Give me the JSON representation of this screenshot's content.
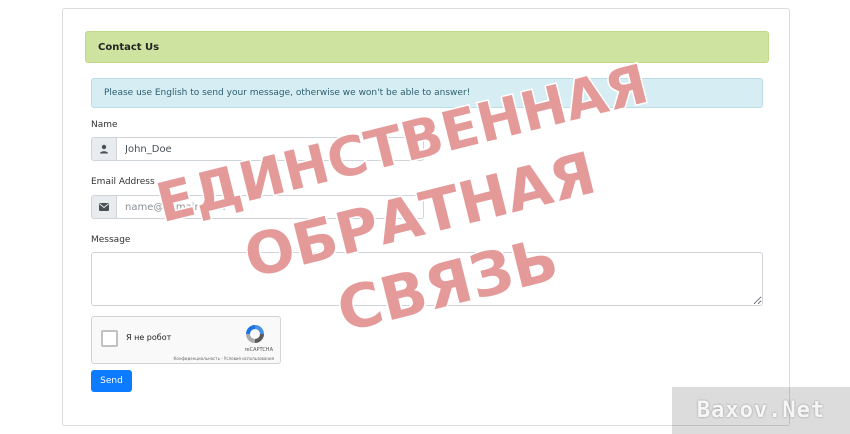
{
  "card": {
    "header_title": "Contact Us",
    "alert_text": "Please use English to send your message, otherwise we won't be able to answer!"
  },
  "form": {
    "name_label": "Name",
    "name_value": "John_Doe",
    "email_label": "Email Address",
    "email_placeholder": "name@domain.com",
    "message_label": "Message",
    "send_label": "Send"
  },
  "captcha": {
    "label": "Я не робот",
    "brand": "reCAPTCHA",
    "terms": "Конфиденциальность - Условия использования"
  },
  "overlay_stamp": {
    "lines": [
      "ЕДИНСТВЕННАЯ",
      "ОБРАТНАЯ",
      "СВЯЗЬ"
    ],
    "color": "#e59a9a"
  },
  "watermark": {
    "text": "Baxov.Net"
  },
  "colors": {
    "header_bg": "#cfe3a1",
    "alert_bg": "#d6edf3",
    "button_bg": "#0d7bff"
  },
  "icons": {
    "name_field": "user-icon",
    "email_field": "envelope-icon",
    "captcha": "recaptcha-logo-icon"
  }
}
